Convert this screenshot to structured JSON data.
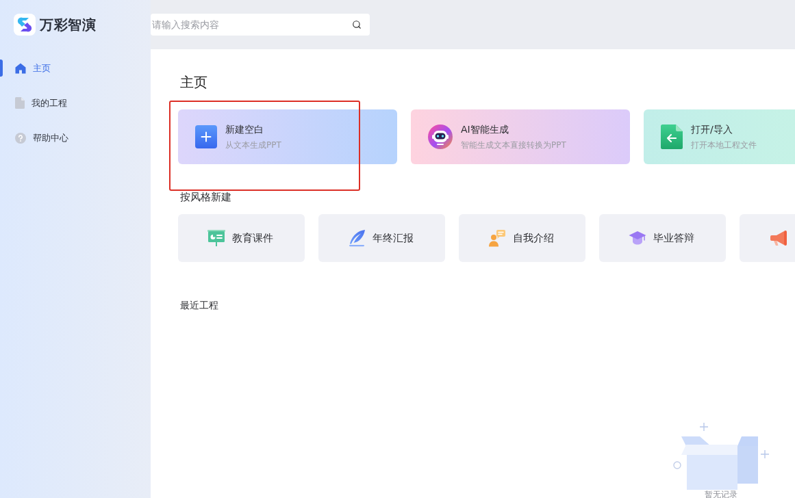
{
  "app": {
    "name": "万彩智演"
  },
  "search": {
    "placeholder": "请输入搜索内容"
  },
  "sidebar": {
    "items": [
      {
        "kind": "home",
        "label": "主页",
        "selected": true
      },
      {
        "kind": "file",
        "label": "我的工程",
        "selected": false
      },
      {
        "kind": "help",
        "label": "帮助中心",
        "selected": false
      }
    ]
  },
  "main": {
    "title": "主页",
    "quick_actions": [
      {
        "kind": "blank",
        "title": "新建空白",
        "subtitle": "从文本生成PPT",
        "highlighted": true
      },
      {
        "kind": "ai",
        "title": "AI智能生成",
        "subtitle": "智能生成文本直接转换为PPT",
        "highlighted": false
      },
      {
        "kind": "open",
        "title": "打开/导入",
        "subtitle": "打开本地工程文件",
        "highlighted": false
      }
    ],
    "styles_heading": "按风格新建",
    "styles": [
      {
        "kind": "education",
        "label": "教育课件"
      },
      {
        "kind": "report",
        "label": "年终汇报"
      },
      {
        "kind": "intro",
        "label": "自我介绍"
      },
      {
        "kind": "graduation",
        "label": "毕业答辩"
      },
      {
        "kind": "promotion"
      }
    ],
    "recent_heading": "最近工程",
    "recent_empty": "暂无记录"
  }
}
